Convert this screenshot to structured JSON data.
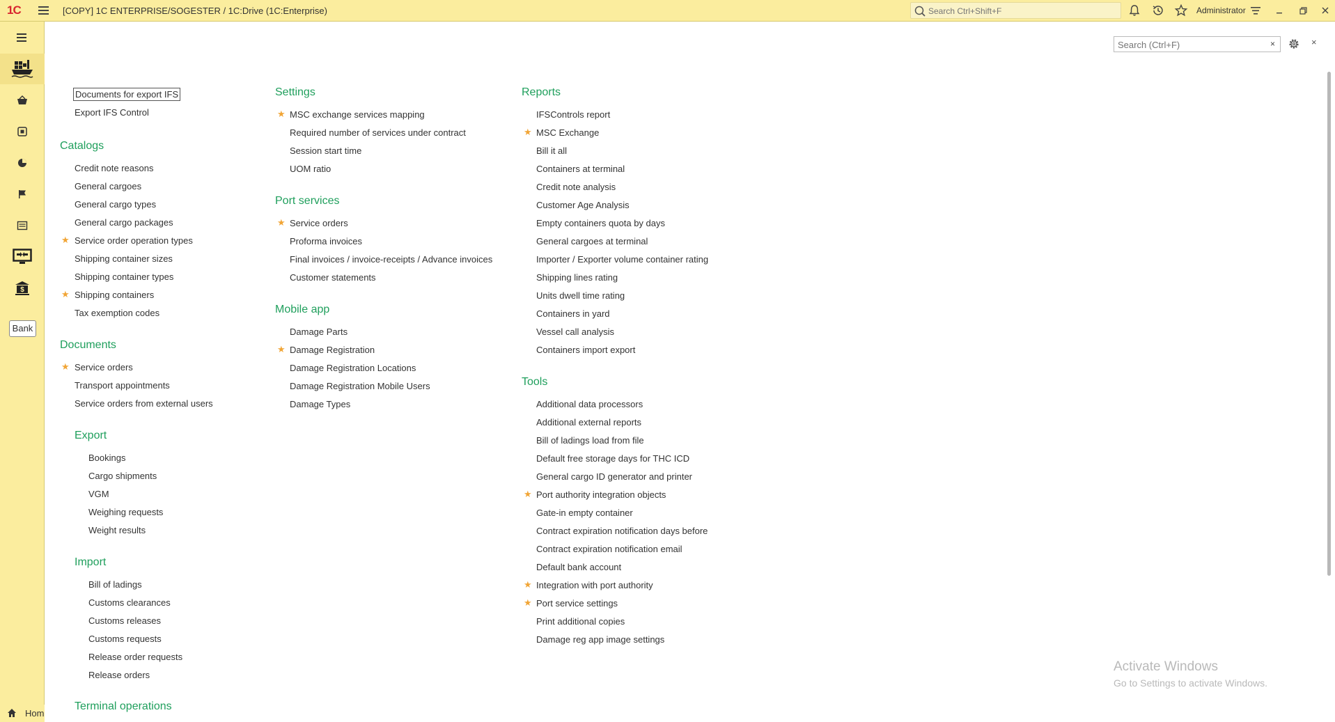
{
  "titlebar": {
    "logo": "1C",
    "title": "[COPY] 1C ENTERPRISE/SOGESTER / 1C:Drive  (1C:Enterprise)",
    "search_placeholder": "Search Ctrl+Shift+F",
    "user": "Administrator"
  },
  "sidebar": {
    "bank_label": "Bank",
    "home_label": "Hom"
  },
  "panel": {
    "search_placeholder": "Search (Ctrl+F)",
    "clear_label": "×",
    "close_label": "×"
  },
  "col1": {
    "top_links": [
      "Documents for export IFS",
      "Export IFS Control"
    ],
    "catalogs_title": "Catalogs",
    "catalogs": [
      "Credit note reasons",
      "General cargoes",
      "General cargo types",
      "General cargo packages",
      "Service order operation types",
      "Shipping container sizes",
      "Shipping container types",
      "Shipping containers",
      "Tax exemption codes"
    ],
    "documents_title": "Documents",
    "documents": [
      "Service orders",
      "Transport appointments",
      "Service orders from external users"
    ],
    "export_title": "Export",
    "export": [
      "Bookings",
      "Cargo shipments",
      "VGM",
      "Weighing requests",
      "Weight results"
    ],
    "import_title": "Import",
    "import": [
      "Bill of ladings",
      "Customs clearances",
      "Customs releases",
      "Customs requests",
      "Release order requests",
      "Release orders"
    ],
    "terminal_title": "Terminal operations"
  },
  "col2": {
    "settings_title": "Settings",
    "settings": [
      "MSC exchange services mapping",
      "Required number of services under contract",
      "Session start time",
      "UOM ratio"
    ],
    "port_title": "Port services",
    "port": [
      "Service orders",
      "Proforma invoices",
      "Final invoices / invoice-receipts / Advance invoices",
      "Customer statements"
    ],
    "mobile_title": "Mobile app",
    "mobile": [
      "Damage Parts",
      "Damage Registration",
      "Damage Registration Locations",
      "Damage Registration Mobile Users",
      "Damage Types"
    ]
  },
  "col3": {
    "reports_title": "Reports",
    "reports": [
      "IFSControls report",
      "MSC Exchange",
      "Bill it all",
      "Containers at terminal",
      "Credit note analysis",
      "Customer Age Analysis",
      "Empty containers quota by days",
      "General cargoes at terminal",
      "Importer / Exporter volume container rating",
      "Shipping lines rating",
      "Units dwell time rating",
      "Containers in yard",
      "Vessel call analysis",
      "Containers import export"
    ],
    "tools_title": "Tools",
    "tools": [
      "Additional data processors",
      "Additional external reports",
      "Bill of ladings load from file",
      "Default free storage days for THC ICD",
      "General cargo ID generator and printer",
      "Port authority integration objects",
      "Gate-in empty container",
      "Contract expiration notification days before",
      "Contract expiration notification email",
      "Default bank account",
      "Integration with port authority",
      "Port service settings",
      "Print additional copies",
      "Damage reg app image settings"
    ]
  },
  "watermark": {
    "line1": "Activate Windows",
    "line2": "Go to Settings to activate Windows."
  },
  "colors": {
    "accent_green": "#1f9f5c",
    "star_orange": "#f1a536",
    "chrome_yellow": "#fbed9e",
    "logo_red": "#d8262f"
  }
}
